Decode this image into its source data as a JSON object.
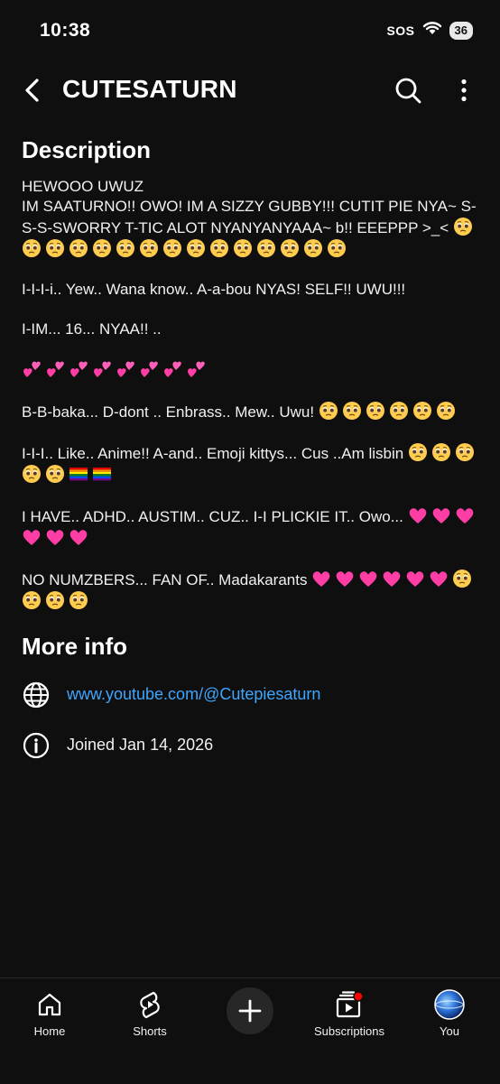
{
  "status_bar": {
    "time": "10:38",
    "sos": "SOS",
    "battery": "36"
  },
  "header": {
    "title": "CUTESATURN"
  },
  "description": {
    "heading": "Description",
    "paragraphs": [
      {
        "text": "HEWOOO UWUZ\nIM SAATURNO!! OWO! IM A SIZZY GUBBY!!! CUTIT PIE NYA~ S-S-S-SWORRY T-TIC ALOT NYANYANYAAA~ b!! EEEPPP >_<",
        "emojis_after": [
          "pleading",
          "pleading",
          "pleading",
          "pleading",
          "pleading",
          "pleading",
          "pleading",
          "pleading",
          "pleading",
          "pleading",
          "pleading",
          "pleading",
          "pleading",
          "pleading",
          "pleading"
        ]
      },
      {
        "text": "I-I-I-i.. Yew.. Wana know.. A-a-bou NYAS! SELF!! UWU!!!",
        "emojis_after": []
      },
      {
        "text": "I-IM... 16... NYAA!! ..",
        "emojis_after": []
      },
      {
        "text": "",
        "emojis_after": [
          "two-hearts",
          "two-hearts",
          "two-hearts",
          "two-hearts",
          "two-hearts",
          "two-hearts",
          "two-hearts",
          "two-hearts"
        ]
      },
      {
        "text": "B-B-baka... D-dont .. Enbrass.. Mew.. Uwu!",
        "emojis_after": [
          "pleading",
          "pleading",
          "pleading",
          "pleading",
          "pleading",
          "pleading"
        ]
      },
      {
        "text": "I-I-I.. Like.. Anime!! A-and.. Emoji kittys... Cus ..Am lisbin",
        "emojis_after": [
          "pleading",
          "pleading",
          "pleading",
          "pleading",
          "pleading",
          "rainbow-flag",
          "rainbow-flag"
        ]
      },
      {
        "text": "I HAVE.. ADHD.. AUSTIM.. CUZ.. I-I PLICKIE IT.. Owo...",
        "emojis_after": [
          "pink-heart",
          "pink-heart",
          "pink-heart",
          "pink-heart",
          "pink-heart",
          "pink-heart"
        ]
      },
      {
        "text": "NO NUMZBERS... FAN OF.. Madakarants",
        "emojis_after": [
          "pink-heart",
          "pink-heart",
          "pink-heart",
          "pink-heart",
          "pink-heart",
          "pink-heart",
          "pleading",
          "pleading",
          "pleading",
          "pleading"
        ]
      }
    ]
  },
  "more_info": {
    "heading": "More info",
    "link": "www.youtube.com/@Cutepiesaturn",
    "joined": "Joined Jan 14, 2026"
  },
  "nav": {
    "home": "Home",
    "shorts": "Shorts",
    "subscriptions": "Subscriptions",
    "you": "You"
  },
  "colors": {
    "background": "#0f0f0f",
    "link": "#3ea6ff",
    "heart": "#ff3ea5"
  }
}
